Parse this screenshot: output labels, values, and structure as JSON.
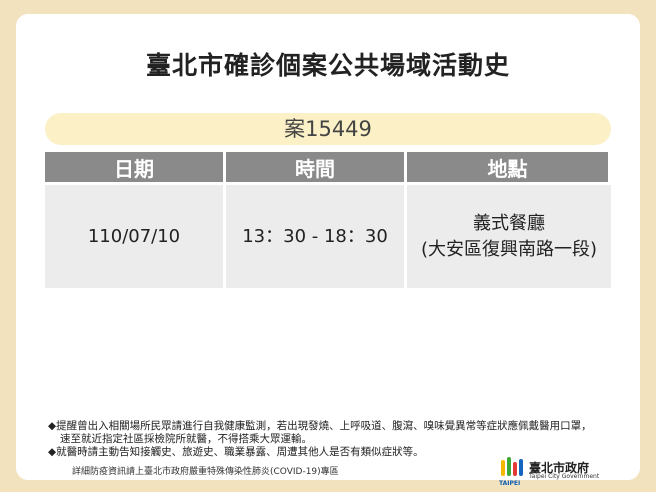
{
  "title": "臺北市確診個案公共場域活動史",
  "case_label": "案15449",
  "table": {
    "headers": [
      "日期",
      "時間",
      "地點"
    ],
    "row": {
      "date": "110/07/10",
      "time": "13：30 - 18：30",
      "place_name": "義式餐廳",
      "place_detail": "(大安區復興南路一段)"
    }
  },
  "notes": {
    "line1": "◆提醒曾出入相關場所民眾請進行自我健康監測，若出現發燒、上呼吸道、腹瀉、嗅味覺異常等症狀應佩戴醫用口罩，",
    "line2": "速至就近指定社區採檢院所就醫，不得搭乘大眾運輸。",
    "line3": "◆就醫時請主動告知接觸史、旅遊史、職業暴露、周遭其他人是否有類似症狀等。"
  },
  "footer_note": "詳細防疫資訊請上臺北市政府嚴重特殊傳染性肺炎(COVID-19)專區",
  "logo": {
    "name_cn": "臺北市政府",
    "name_en": "Taipei City Government",
    "mark_text": "TAIPEI",
    "colors": {
      "yellow": "#f5b800",
      "green": "#3aa935",
      "red": "#e53935",
      "blue": "#1565c0"
    }
  },
  "colors": {
    "background": "#f2e2bd",
    "case_bar": "#fbf0c6",
    "header_cell": "#8a8a8a",
    "data_cell": "#ececec"
  }
}
